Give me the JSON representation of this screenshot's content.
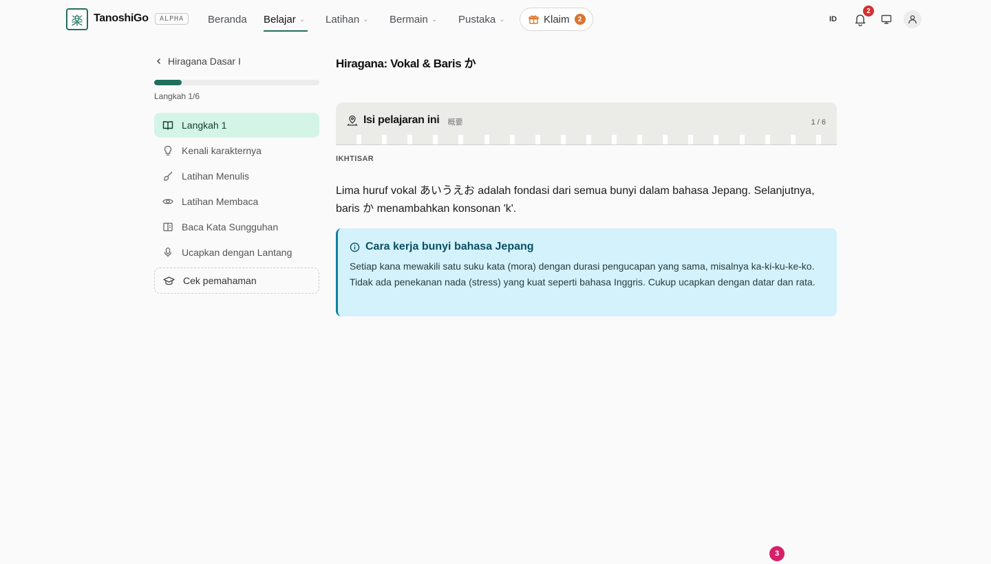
{
  "header": {
    "logo_glyph": "楽",
    "brand": "TanoshiGo",
    "badge": "ALPHA",
    "nav": [
      {
        "label": "Beranda",
        "dropdown": false,
        "active": false
      },
      {
        "label": "Belajar",
        "dropdown": true,
        "active": true
      },
      {
        "label": "Latihan",
        "dropdown": true,
        "active": false
      },
      {
        "label": "Bermain",
        "dropdown": true,
        "active": false
      },
      {
        "label": "Pustaka",
        "dropdown": true,
        "active": false
      }
    ],
    "claim": {
      "label": "Klaim",
      "count": "2"
    },
    "language": "ID",
    "notifications_count": "2",
    "accent_color": "#1f6f5c"
  },
  "sidebar": {
    "back_label": "Hiragana Dasar I",
    "progress_fraction": 0.1667,
    "step_label": "Langkah 1/6",
    "items": [
      {
        "label": "Langkah 1",
        "icon": "book-open-icon",
        "active": true
      },
      {
        "label": "Kenali karakternya",
        "icon": "lightbulb-icon",
        "active": false
      },
      {
        "label": "Latihan Menulis",
        "icon": "brush-icon",
        "active": false
      },
      {
        "label": "Latihan Membaca",
        "icon": "eye-icon",
        "active": false
      },
      {
        "label": "Baca Kata Sungguhan",
        "icon": "book-page-icon",
        "active": false
      },
      {
        "label": "Ucapkan dengan Lantang",
        "icon": "microphone-icon",
        "active": false
      }
    ],
    "check": {
      "label": "Cek pemahaman",
      "icon": "graduation-cap-icon"
    }
  },
  "main": {
    "title": "Hiragana: Vokal & Baris か",
    "card": {
      "title": "Isi pelajaran ini",
      "subtitle": "概要",
      "counter": "1 / 6",
      "icon": "map-pin-icon"
    },
    "section_label": "IKHTISAR",
    "intro": "Lima huruf vokal あいうえお adalah fondasi dari semua bunyi dalam bahasa Jepang. Selanjutnya, baris か menambahkan konsonan 'k'.",
    "info": {
      "icon": "info-icon",
      "title": "Cara kerja bunyi bahasa Jepang",
      "body": "Setiap kana mewakili satu suku kata (mora) dengan durasi pengucapan yang sama, misalnya ka-ki-ku-ke-ko. Tidak ada penekanan nada (stress) yang kuat seperti bahasa Inggris. Cukup ucapkan dengan datar dan rata."
    }
  },
  "floating_badge": "3"
}
